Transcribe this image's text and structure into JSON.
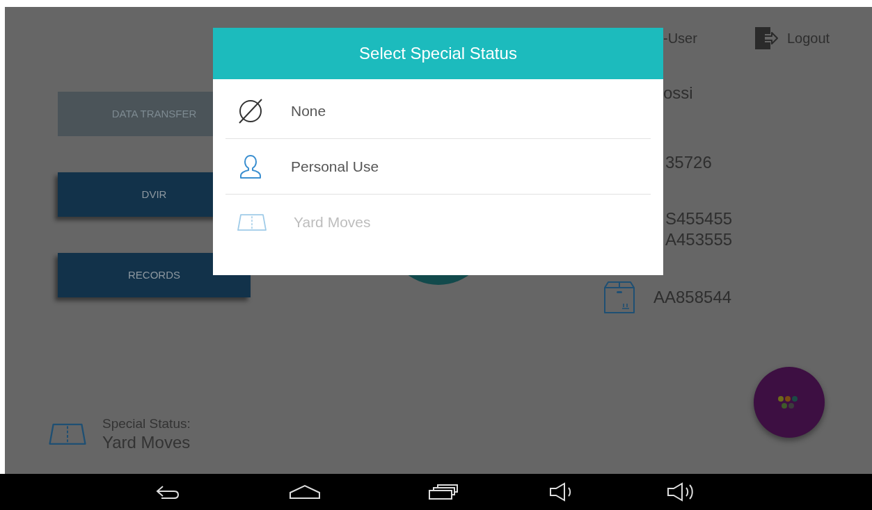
{
  "background": {
    "buttons": [
      {
        "label": "DATA TRANSFER",
        "disabled": true
      },
      {
        "label": "DVIR",
        "disabled": false
      },
      {
        "label": "RECORDS",
        "disabled": false
      }
    ],
    "user": "-User",
    "logout": "Logout",
    "driver_name": "ossi",
    "driver_id": "35726",
    "vehicles": [
      "S455455",
      "A453555"
    ],
    "shipment": "AA858544",
    "special_status": {
      "label": "Special Status:",
      "value": "Yard Moves"
    }
  },
  "dialog": {
    "title": "Select Special Status",
    "options": [
      {
        "kind": "none",
        "label": "None",
        "disabled": false
      },
      {
        "kind": "person",
        "label": "Personal Use",
        "disabled": false
      },
      {
        "kind": "road",
        "label": "Yard Moves",
        "disabled": true
      }
    ]
  }
}
